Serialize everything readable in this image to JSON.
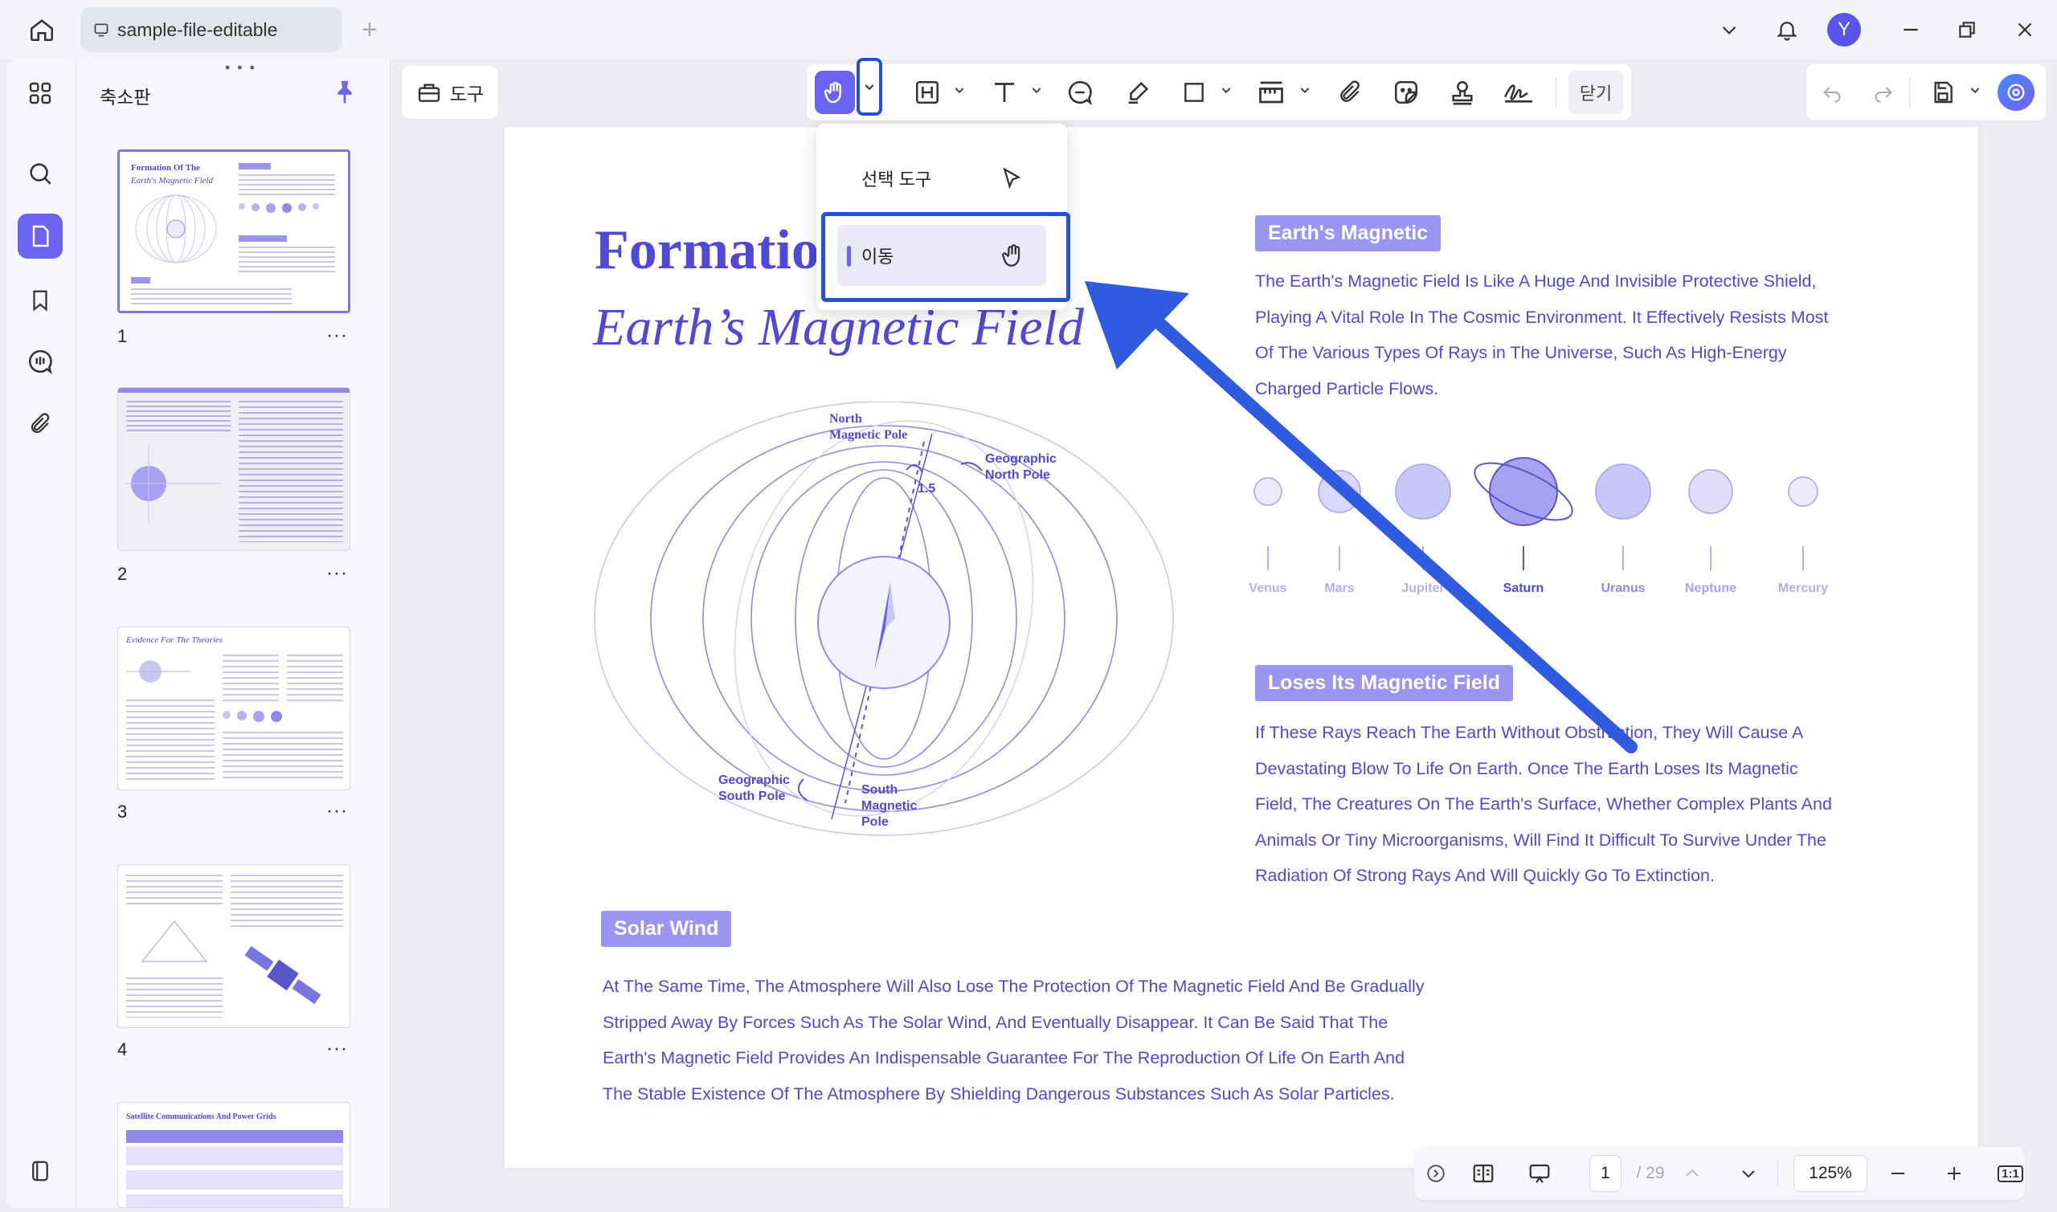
{
  "titlebar": {
    "tab_title": "sample-file-editable",
    "avatar_initial": "Y"
  },
  "panel": {
    "title": "축소판",
    "thumbnails": [
      {
        "number": "1",
        "heading": "Formation Of The",
        "heading2": "Earth's Magnetic Field"
      },
      {
        "number": "2"
      },
      {
        "number": "3",
        "heading": "Evidence For The Theories"
      },
      {
        "number": "4"
      },
      {
        "number": "",
        "heading": "Satellite Communications And Power Grids"
      }
    ],
    "more": "···"
  },
  "toolbar": {
    "tools_label": "도구",
    "close_label": "닫기"
  },
  "dropdown": {
    "select_tool": "선택 도구",
    "move_tool": "이동"
  },
  "document": {
    "title": "Formatio",
    "subtitle": "Earth’s Magnetic Field",
    "diagram": {
      "north_magnetic": "North",
      "north_magnetic2": "Magnetic Pole",
      "geo_north": "Geographic",
      "geo_north2": "North Pole",
      "angle": "1.5",
      "geo_south": "Geographic",
      "geo_south2": "South Pole",
      "south_magnetic": "South",
      "south_magnetic2": "Magnetic",
      "south_magnetic3": "Pole"
    },
    "section1": {
      "badge": "Earth's Magnetic",
      "lines": [
        "The Earth's Magnetic Field Is Like A Huge And Invisible Protective Shield,",
        "Playing A Vital Role In The Cosmic Environment. It Effectively Resists Most",
        "Of The Various Types Of Rays in The Universe, Such As High-Energy",
        "Charged Particle Flows."
      ]
    },
    "planets": [
      "Venus",
      "Mars",
      "Jupiter",
      "Saturn",
      "Uranus",
      "Neptune",
      "Mercury"
    ],
    "section2": {
      "badge": "Loses Its Magnetic Field",
      "lines": [
        "If These Rays Reach The Earth Without Obstruction, They Will Cause A",
        "Devastating Blow To Life On Earth. Once The Earth Loses Its Magnetic",
        "Field, The Creatures On The Earth's Surface, Whether Complex Plants And",
        "Animals Or Tiny Microorganisms, Will Find It Difficult To Survive Under The",
        "Radiation Of Strong Rays And Will Quickly Go To Extinction."
      ]
    },
    "section3": {
      "badge": "Solar Wind",
      "lines": [
        "At The Same Time, The Atmosphere Will Also Lose The Protection Of The Magnetic Field And Be Gradually",
        "Stripped Away By Forces Such As The Solar Wind, And Eventually Disappear. It Can Be Said That The",
        "Earth's Magnetic Field Provides An Indispensable Guarantee For The Reproduction Of Life On Earth And",
        "The Stable Existence Of The Atmosphere By Shielding Dangerous Substances Such As Solar Particles."
      ]
    }
  },
  "bottombar": {
    "page_current": "1",
    "page_total": "/ 29",
    "zoom": "125%",
    "fit_label": "1:1"
  },
  "colors": {
    "accent": "#6b64f2",
    "highlight_frame": "#2350d8",
    "doc_text": "#5048d8"
  }
}
